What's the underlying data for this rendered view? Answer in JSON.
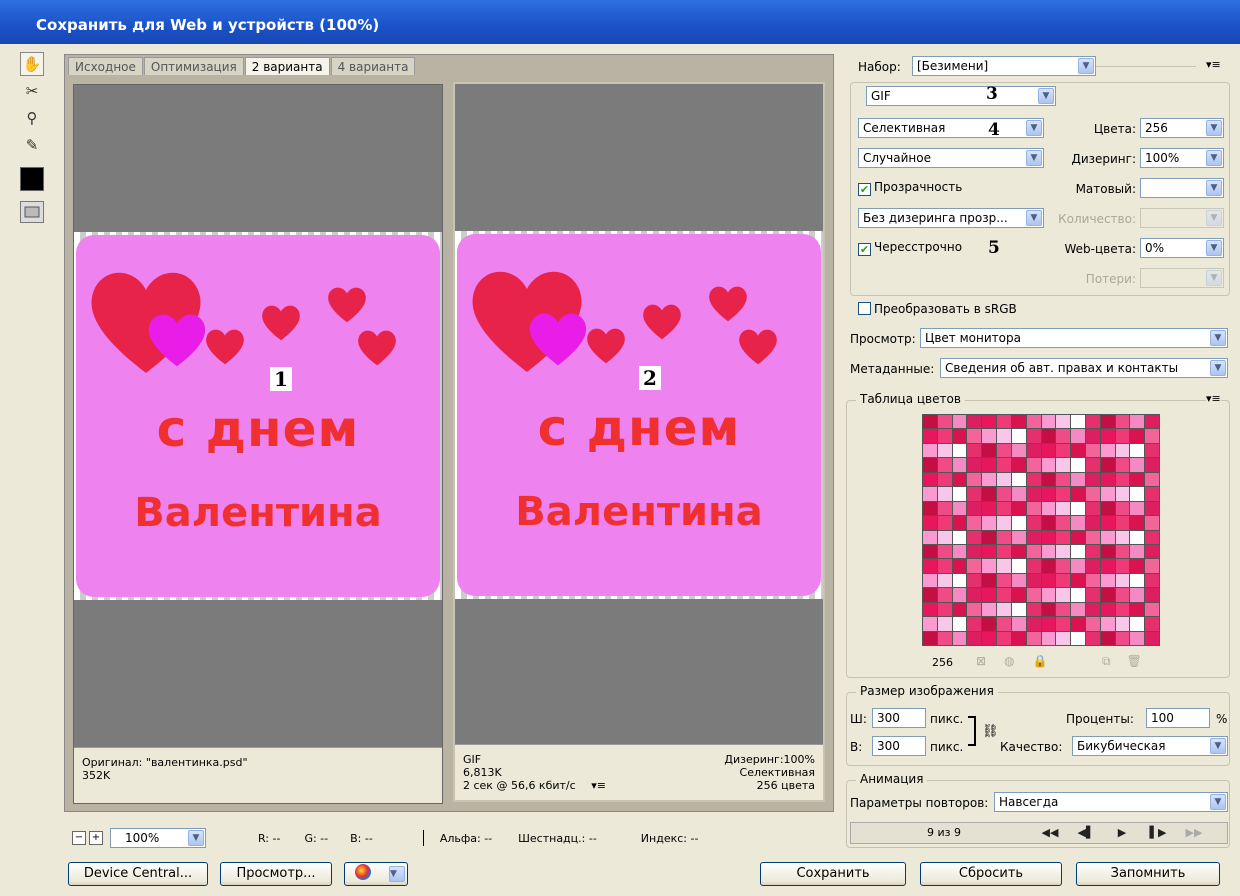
{
  "window": {
    "title": "Сохранить для Web и устройств (100%)"
  },
  "tools": [
    {
      "name": "hand-tool-icon",
      "glyph": "✋"
    },
    {
      "name": "slice-select-tool-icon",
      "glyph": "✂"
    },
    {
      "name": "zoom-tool-icon",
      "glyph": "🔍"
    },
    {
      "name": "eyedropper-tool-icon",
      "glyph": "✎"
    }
  ],
  "tabs": [
    "Исходное",
    "Оптимизация",
    "2 варианта",
    "4 варианта"
  ],
  "active_tab": "2 варианта",
  "preview": {
    "pane1": {
      "marker": "1",
      "line1": "с днем",
      "line2": "Валентина",
      "info_left_1": "Оригинал: \"валентинка.psd\"",
      "info_left_2": "352K"
    },
    "pane2": {
      "marker": "2",
      "line1": "с днем",
      "line2": "Валентина",
      "info_left_1": "GIF",
      "info_left_2": "6,813K",
      "info_left_3": "2 сек @ 56,6 кбит/с",
      "info_right_1": "Дизеринг:100%",
      "info_right_2": "Селективная",
      "info_right_3": "256 цвета"
    }
  },
  "statusbar": {
    "zoom": "100%",
    "r": "R: --",
    "g": "G: --",
    "b": "B: --",
    "alpha": "Альфа: --",
    "hex": "Шестнадц.: --",
    "index": "Индекс: --"
  },
  "bottom_buttons": {
    "device_central": "Device Central...",
    "preview": "Просмотр...",
    "save": "Сохранить",
    "reset": "Сбросить",
    "remember": "Запомнить"
  },
  "settings": {
    "preset_label": "Набор:",
    "preset_value": "[Безимени]",
    "format": "GIF",
    "reduction": "Селективная",
    "dither_algo": "Случайное",
    "transparency_label": "Прозрачность",
    "transparency_checked": true,
    "matte_dither": "Без дизеринга прозр...",
    "interlaced_label": "Чересстрочно",
    "interlaced_checked": true,
    "colors_label": "Цвета:",
    "colors_value": "256",
    "dither_label": "Дизеринг:",
    "dither_value": "100%",
    "matte_label": "Матовый:",
    "matte_value": "",
    "amount_label": "Количество:",
    "web_snap_label": "Web-цвета:",
    "web_snap_value": "0%",
    "lossy_label": "Потери:",
    "annotations": {
      "a3": "3",
      "a4": "4",
      "a5": "5"
    }
  },
  "convert_srgb": {
    "label": "Преобразовать в sRGB",
    "checked": false
  },
  "view": {
    "label": "Просмотр:",
    "value": "Цвет монитора"
  },
  "metadata": {
    "label": "Метаданные:",
    "value": "Сведения об авт. правах и контакты"
  },
  "color_table": {
    "title": "Таблица цветов",
    "count": "256",
    "colors": [
      "#e8175d",
      "#f03a78",
      "#d8134f",
      "#f2659a",
      "#fa9ad0",
      "#f7c6e8",
      "#ffffff",
      "#e6306e",
      "#c40f45",
      "#ef4b86",
      "#f48ac1",
      "#dd1f62"
    ]
  },
  "image_size": {
    "title": "Размер изображения",
    "w_label": "Ш:",
    "w_value": "300",
    "w_unit": "пикс.",
    "h_label": "В:",
    "h_value": "300",
    "h_unit": "пикс.",
    "percent_label": "Проценты:",
    "percent_value": "100",
    "percent_unit": "%",
    "quality_label": "Качество:",
    "quality_value": "Бикубическая"
  },
  "animation": {
    "title": "Анимация",
    "loop_label": "Параметры повторов:",
    "loop_value": "Навсегда",
    "frame_counter": "9 из 9"
  }
}
